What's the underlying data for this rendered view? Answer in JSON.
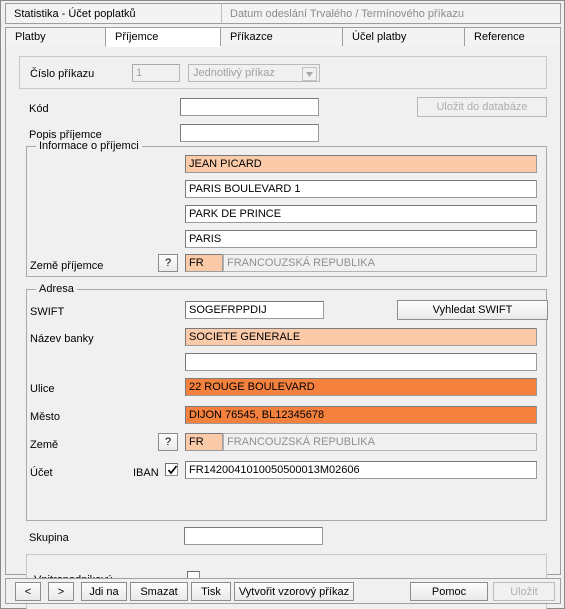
{
  "header": {
    "left_tab": "Statistika - Účet poplatků",
    "right_tab": "Datum odeslání Trvalého / Termínového příkazu"
  },
  "tabs": [
    {
      "label": "Platby",
      "active": false
    },
    {
      "label": "Příjemce",
      "active": true
    },
    {
      "label": "Příkazce",
      "active": false
    },
    {
      "label": "Účel platby",
      "active": false
    },
    {
      "label": "Reference",
      "active": false
    }
  ],
  "order": {
    "number_label": "Číslo příkazu",
    "number_value": "1",
    "type_value": "Jednotlivý příkaz"
  },
  "code": {
    "code_label": "Kód",
    "code_value": "",
    "description_label": "Popis příjemce",
    "description_value": "",
    "save_db_button": "Uložit do databáze"
  },
  "recipient_info": {
    "title": "Informace o příjemci",
    "lines": [
      "JEAN PICARD",
      "PARIS BOULEVARD 1",
      "PARK DE PRINCE",
      "PARIS"
    ],
    "country_label": "Země příjemce",
    "country_help_button": "?",
    "country_code": "FR",
    "country_name": "FRANCOUZSKÁ REPUBLIKA"
  },
  "address": {
    "title": "Adresa",
    "swift_label": "SWIFT",
    "swift_value": "SOGEFRPPDIJ",
    "swift_button": "Vyhledat SWIFT",
    "bank_name_label": "Název banky",
    "bank_name_value": "SOCIETE GENERALE",
    "bank_name_value2": "",
    "street_label": "Ulice",
    "street_value": "22 ROUGE BOULEVARD",
    "city_label": "Město",
    "city_value": "DIJON 76545, BL12345678",
    "country_label": "Země",
    "country_help_button": "?",
    "country_code": "FR",
    "country_name": "FRANCOUZSKÁ REPUBLIKA",
    "account_label": "Účet",
    "iban_label": "IBAN",
    "iban_checked": true,
    "account_value": "FR1420041010050500013M02606"
  },
  "group": {
    "label": "Skupina",
    "value": ""
  },
  "internal": {
    "label": "Vnitropodnikový",
    "checked": false
  },
  "toolbar": {
    "prev": "<",
    "next": ">",
    "goto": "Jdi na",
    "delete": "Smazat",
    "print": "Tisk",
    "create_template": "Vytvořit vzorový příkaz",
    "help": "Pomoc",
    "save": "Uložit"
  },
  "colors": {
    "highlight_light": "#fbcaa9",
    "highlight_strong": "#f5813f",
    "window_bg": "#f0f0f0"
  }
}
